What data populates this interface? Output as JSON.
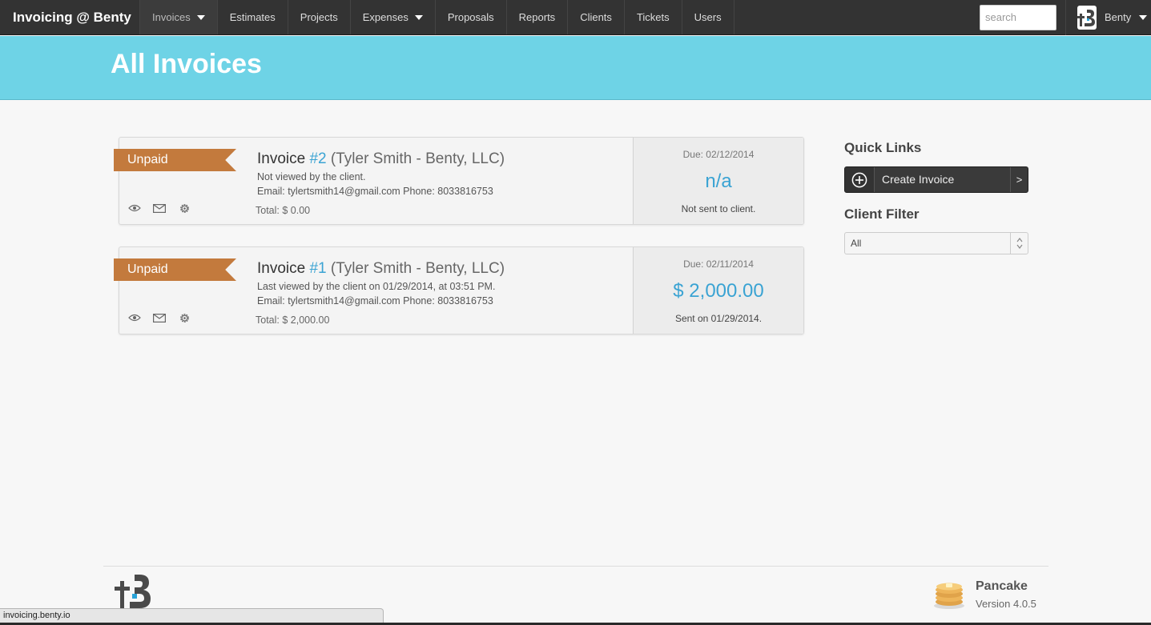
{
  "nav": {
    "brand": "Invoicing @ Benty",
    "items": [
      {
        "label": "Invoices",
        "dropdown": true,
        "active": true
      },
      {
        "label": "Estimates",
        "dropdown": false
      },
      {
        "label": "Projects",
        "dropdown": false
      },
      {
        "label": "Expenses",
        "dropdown": true
      },
      {
        "label": "Proposals",
        "dropdown": false
      },
      {
        "label": "Reports",
        "dropdown": false
      },
      {
        "label": "Clients",
        "dropdown": false
      },
      {
        "label": "Tickets",
        "dropdown": false
      },
      {
        "label": "Users",
        "dropdown": false
      }
    ],
    "search_placeholder": "search",
    "user_name": "Benty"
  },
  "header": {
    "title": "All Invoices"
  },
  "invoices": [
    {
      "status": "Unpaid",
      "title_word": "Invoice",
      "number": "#2",
      "client": "(Tyler Smith - Benty, LLC)",
      "view_status": "Not viewed by the client.",
      "contact": "Email: tylertsmith14@gmail.com Phone: 8033816753",
      "total": "Total: $ 0.00",
      "due": "Due: 02/12/2014",
      "amount": "n/a",
      "sent": "Not sent to client."
    },
    {
      "status": "Unpaid",
      "title_word": "Invoice",
      "number": "#1",
      "client": "(Tyler Smith - Benty, LLC)",
      "view_status": "Last viewed by the client on 01/29/2014, at 03:51 PM.",
      "contact": "Email: tylertsmith14@gmail.com Phone: 8033816753",
      "total": "Total: $ 2,000.00",
      "due": "Due: 02/11/2014",
      "amount": "$ 2,000.00",
      "sent": "Sent on 01/29/2014."
    }
  ],
  "sidebar": {
    "quick_links_title": "Quick Links",
    "create_invoice_label": "Create Invoice",
    "create_invoice_arrow": ">",
    "client_filter_title": "Client Filter",
    "client_filter_value": "All"
  },
  "footer": {
    "product_name": "Pancake",
    "version": "Version 4.0.5"
  },
  "status_bar": {
    "url": "invoicing.benty.io"
  },
  "colors": {
    "nav_bg": "#333333",
    "header_bg": "#6ed3e6",
    "ribbon": "#c37a3d",
    "accent_blue": "#3aa3d3"
  }
}
